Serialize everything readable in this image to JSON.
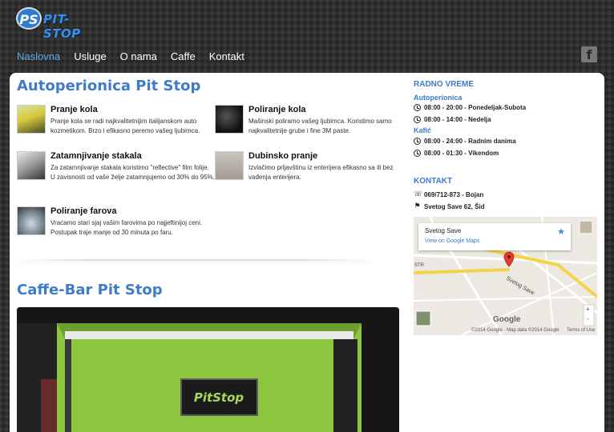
{
  "header": {
    "logo_mark": "PS",
    "logo_text": "PIT-STOP",
    "nav": [
      "Naslovna",
      "Usluge",
      "O nama",
      "Caffe",
      "Kontakt"
    ],
    "facebook_glyph": "f"
  },
  "main": {
    "title": "Autoperionica Pit Stop",
    "services": [
      {
        "title": "Pranje kola",
        "text": "Pranje kola se radi najkvalitetnijim italijanskom auto kozmetikom. Brzo i efikasno peremo vašeg ljubimca."
      },
      {
        "title": "Poliranje kola",
        "text": "Mašinski poliramo vašeg ljubimca. Koristimo samo najkvalitetnije grube i fine 3M paste."
      },
      {
        "title": "Zatamnjivanje stakala",
        "text": "Za zatamnjivanje stakala koristimo \"reflective\" film folije. U zavisnosti od vaše želje zatamnjujemo od 30% do 95%."
      },
      {
        "title": "Dubinsko pranje",
        "text": "Izvlačimo prljavštinu iz enterijera efikasno sa ili bez vađenja enterijera."
      },
      {
        "title": "Poliranje farova",
        "text": "Vraćamo stari sjaj vašim farovima po najjeftinijoj ceni. Postupak traje manje od 30 minuta po faru."
      }
    ],
    "caffe_title": "Caffe-Bar Pit Stop",
    "photo_sign": "PitStop"
  },
  "sidebar": {
    "hours_title": "RADNO VREME",
    "car_wash_label": "Autoperionica",
    "car_wash_hours": [
      "08:00 - 20:00 - Ponedeljak-Subota",
      "08:00 - 14:00 - Nedelja"
    ],
    "cafe_label": "Kafić",
    "cafe_hours": [
      "08:00 - 24:00 - Radnim danima",
      "08:00 - 01:30 - Vikendom"
    ],
    "contact_title": "KONTAKT",
    "phone": "069/712-873 - Bojan",
    "address": "Svetog Save 62, Šid",
    "map": {
      "place": "Svetog Save",
      "link": "View on Google Maps",
      "road_label": "Svetog Save",
      "google": "Google",
      "copyright": "©2014 Google - Map data ©2014 Google",
      "terms": "Terms of Use",
      "zoom_in": "+",
      "zoom_out": "-",
      "str_label": "STR"
    }
  }
}
